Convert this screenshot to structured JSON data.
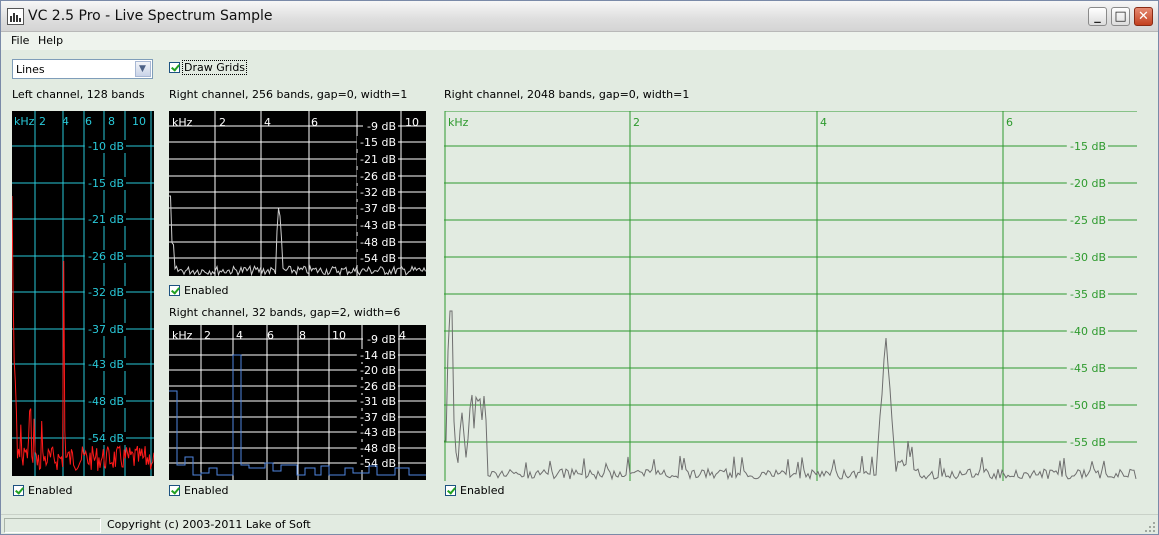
{
  "window": {
    "title": "VC 2.5 Pro - Live Spectrum Sample",
    "minimize_glyph": "_",
    "maximize_glyph": "□",
    "close_glyph": "✕"
  },
  "menu": {
    "file": "File",
    "help": "Help"
  },
  "controls": {
    "mode_value": "Lines",
    "draw_grids_label": "Draw Grids",
    "draw_grids_checked": true
  },
  "panels": {
    "left": {
      "caption": "Left channel, 128 bands",
      "enabled_label": "Enabled",
      "trace_color": "#ff1a1a",
      "grid_color": "#29c9d9",
      "freq_labels": [
        "kHz",
        "2",
        "4",
        "6",
        "8",
        "10"
      ],
      "db_labels": [
        "-10 dB",
        "-15 dB",
        "-21 dB",
        "-26 dB",
        "-32 dB",
        "-37 dB",
        "-43 dB",
        "-48 dB",
        "-54 dB"
      ]
    },
    "mid_top": {
      "caption": "Right channel, 256 bands, gap=0, width=1",
      "enabled_label": "Enabled",
      "trace_color": "#cfcfcf",
      "grid_color": "#ffffff",
      "freq_labels": [
        "kHz",
        "2",
        "4",
        "6",
        "10"
      ],
      "db_labels": [
        "-9 dB",
        "-15 dB",
        "-21 dB",
        "-26 dB",
        "-32 dB",
        "-37 dB",
        "-43 dB",
        "-48 dB",
        "-54 dB"
      ]
    },
    "mid_bottom": {
      "caption": "Right channel, 32 bands, gap=2, width=6",
      "enabled_label": "Enabled",
      "trace_color": "#4f86e0",
      "grid_color": "#ffffff",
      "freq_labels": [
        "kHz",
        "2",
        "4",
        "6",
        "8",
        "10",
        "4"
      ],
      "db_labels": [
        "-9 dB",
        "-14 dB",
        "-20 dB",
        "-26 dB",
        "-31 dB",
        "-37 dB",
        "-43 dB",
        "-48 dB",
        "-54 dB"
      ]
    },
    "right": {
      "caption": "Right channel, 2048 bands, gap=0, width=1",
      "enabled_label": "Enabled",
      "trace_color": "#6e6e6e",
      "grid_color": "#2e9a2e",
      "freq_labels": [
        "kHz",
        "2",
        "4",
        "6"
      ],
      "db_labels": [
        "-15 dB",
        "-20 dB",
        "-25 dB",
        "-30 dB",
        "-35 dB",
        "-40 dB",
        "-45 dB",
        "-50 dB",
        "-55 dB"
      ]
    }
  },
  "status": {
    "copyright": "Copyright (c) 2003-2011 Lake of Soft"
  }
}
